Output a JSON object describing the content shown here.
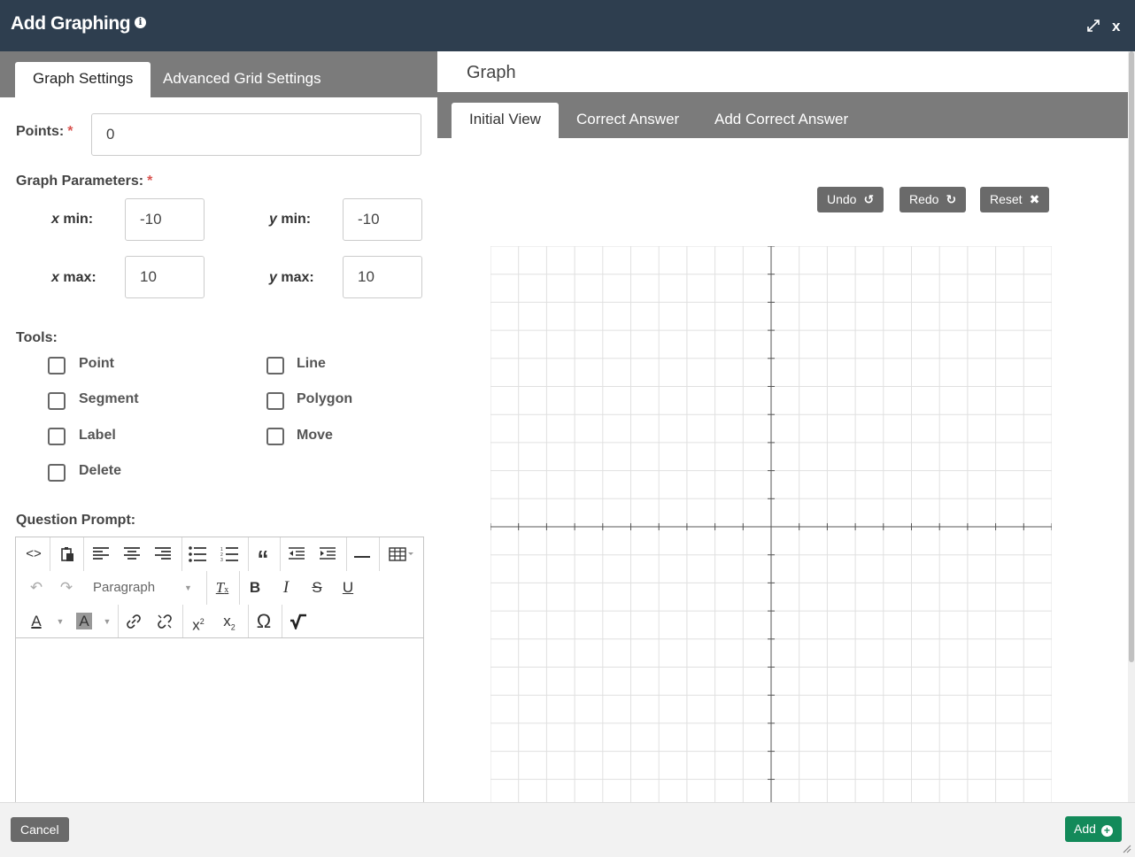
{
  "window": {
    "title": "Add Graphing",
    "info_icon": "info-icon",
    "expand_icon": "expand-icon",
    "close_label": "x"
  },
  "left": {
    "tabs": [
      {
        "label": "Graph Settings",
        "active": true
      },
      {
        "label": "Advanced Grid Settings",
        "active": false
      }
    ],
    "points": {
      "label": "Points:",
      "required": "*",
      "value": "0"
    },
    "graph_params": {
      "label": "Graph Parameters:",
      "required": "*",
      "xmin": {
        "var": "x",
        "suffix": " min:",
        "value": "-10"
      },
      "ymin": {
        "var": "y",
        "suffix": " min:",
        "value": "-10"
      },
      "xmax": {
        "var": "x",
        "suffix": " max:",
        "value": "10"
      },
      "ymax": {
        "var": "y",
        "suffix": " max:",
        "value": "10"
      }
    },
    "tools": {
      "label": "Tools:",
      "items": [
        {
          "label": "Point",
          "checked": false
        },
        {
          "label": "Line",
          "checked": false
        },
        {
          "label": "Segment",
          "checked": false
        },
        {
          "label": "Polygon",
          "checked": false
        },
        {
          "label": "Label",
          "checked": false
        },
        {
          "label": "Move",
          "checked": false
        },
        {
          "label": "Delete",
          "checked": false
        }
      ]
    },
    "prompt": {
      "label": "Question Prompt:",
      "format_select": "Paragraph"
    }
  },
  "right": {
    "heading": "Graph",
    "tabs": [
      {
        "label": "Initial View",
        "active": true
      },
      {
        "label": "Correct Answer",
        "active": false
      },
      {
        "label": "Add Correct Answer",
        "active": false
      }
    ],
    "buttons": {
      "undo": "Undo",
      "redo": "Redo",
      "reset": "Reset"
    },
    "grid": {
      "xmin": -10,
      "xmax": 10,
      "ymin": -10,
      "ymax": 10,
      "gridlines": true
    }
  },
  "footer": {
    "cancel": "Cancel",
    "add": "Add"
  },
  "colors": {
    "titlebar": "#2e3e4f",
    "tab_bar": "#7b7b7b",
    "add_button": "#138a5a",
    "required": "#d9534f"
  }
}
